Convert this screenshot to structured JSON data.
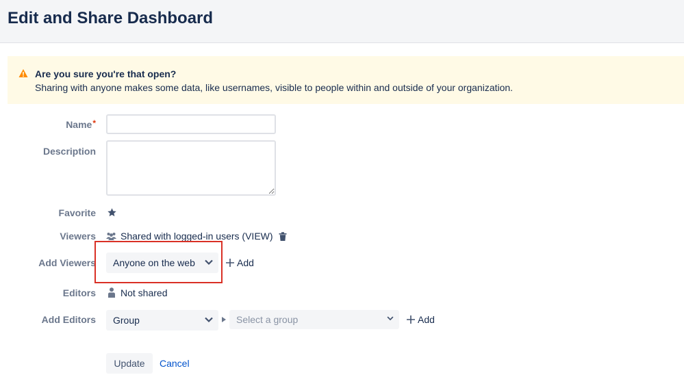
{
  "page": {
    "title": "Edit and Share Dashboard"
  },
  "warning": {
    "icon": "warning-icon",
    "title": "Are you sure you're that open?",
    "text": "Sharing with anyone makes some data, like usernames, visible to people within and outside of your organization.",
    "icon_color": "#ff8b00"
  },
  "form": {
    "name_label": "Name",
    "required_marker": "*",
    "name_value": "",
    "description_label": "Description",
    "description_value": "",
    "favorite_label": "Favorite",
    "favorite_icon": "star-icon",
    "favorite_active": true,
    "viewers_label": "Viewers",
    "viewers_shared": "Shared with logged-in users (VIEW)",
    "add_viewers_label": "Add Viewers",
    "add_viewers_selected": "Anyone on the web",
    "add_viewers_link": "Add",
    "editors_label": "Editors",
    "editors_value": "Not shared",
    "add_editors_label": "Add Editors",
    "add_editors_type": "Group",
    "add_editors_group_placeholder": "Select a group",
    "add_editors_link": "Add",
    "update_label": "Update",
    "cancel_label": "Cancel"
  },
  "colors": {
    "highlight_border": "#d93025",
    "link": "#0052cc",
    "required": "#de350b"
  }
}
